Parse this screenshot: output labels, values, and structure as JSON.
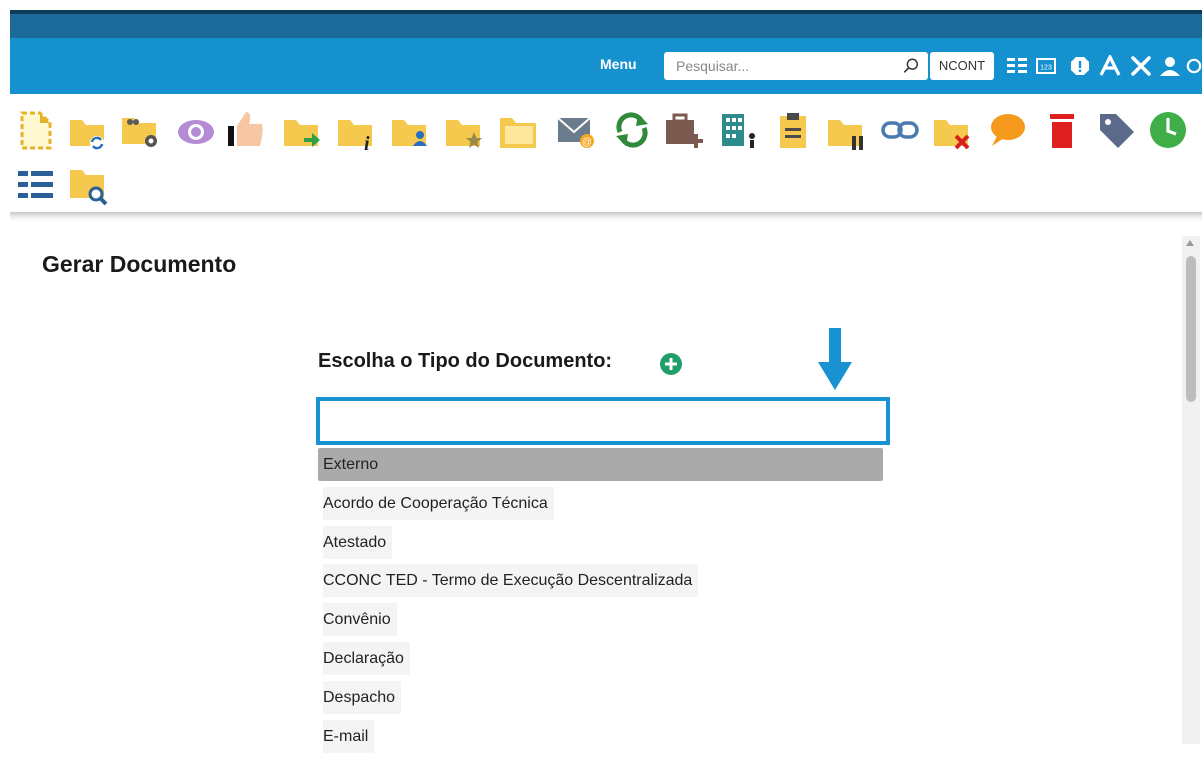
{
  "header": {
    "menu_label": "Menu",
    "search_placeholder": "Pesquisar...",
    "unit": "NCONT",
    "icons": [
      "list-icon",
      "calculator-icon",
      "alert-icon",
      "font-size-icon",
      "tools-icon",
      "user-icon",
      "clock-icon"
    ]
  },
  "toolbar": {
    "icons": [
      "new-document-icon",
      "folder-sync-icon",
      "folder-users-settings-icon",
      "eye-icon",
      "thumbs-up-icon",
      "folder-forward-icon",
      "folder-info-icon",
      "folder-user-icon",
      "folder-star-icon",
      "folder-open-icon",
      "envelope-email-icon",
      "refresh-icon",
      "briefcase-add-icon",
      "building-user-icon",
      "clipboard-icon",
      "folder-pause-icon",
      "link-icon",
      "folder-delete-icon",
      "comment-icon",
      "trash-icon",
      "tag-icon",
      "clock-icon",
      "list-icon",
      "folder-search-icon"
    ]
  },
  "page": {
    "title": "Gerar Documento",
    "choose_type_label": "Escolha o Tipo do Documento:"
  },
  "document_types": {
    "filter_value": "",
    "items": [
      "Externo",
      "Acordo de Cooperação Técnica",
      "Atestado",
      "CCONC TED - Termo de Execução Descentralizada",
      "Convênio",
      "Declaração",
      "Despacho",
      "E-mail"
    ],
    "selected": "Externo"
  },
  "colors": {
    "header_blue": "#1691cf",
    "header_dark": "#1b6a9a",
    "folder_yellow": "#f5c94d",
    "highlight_border": "#1892d0",
    "selected_row": "#aaaaaa"
  }
}
